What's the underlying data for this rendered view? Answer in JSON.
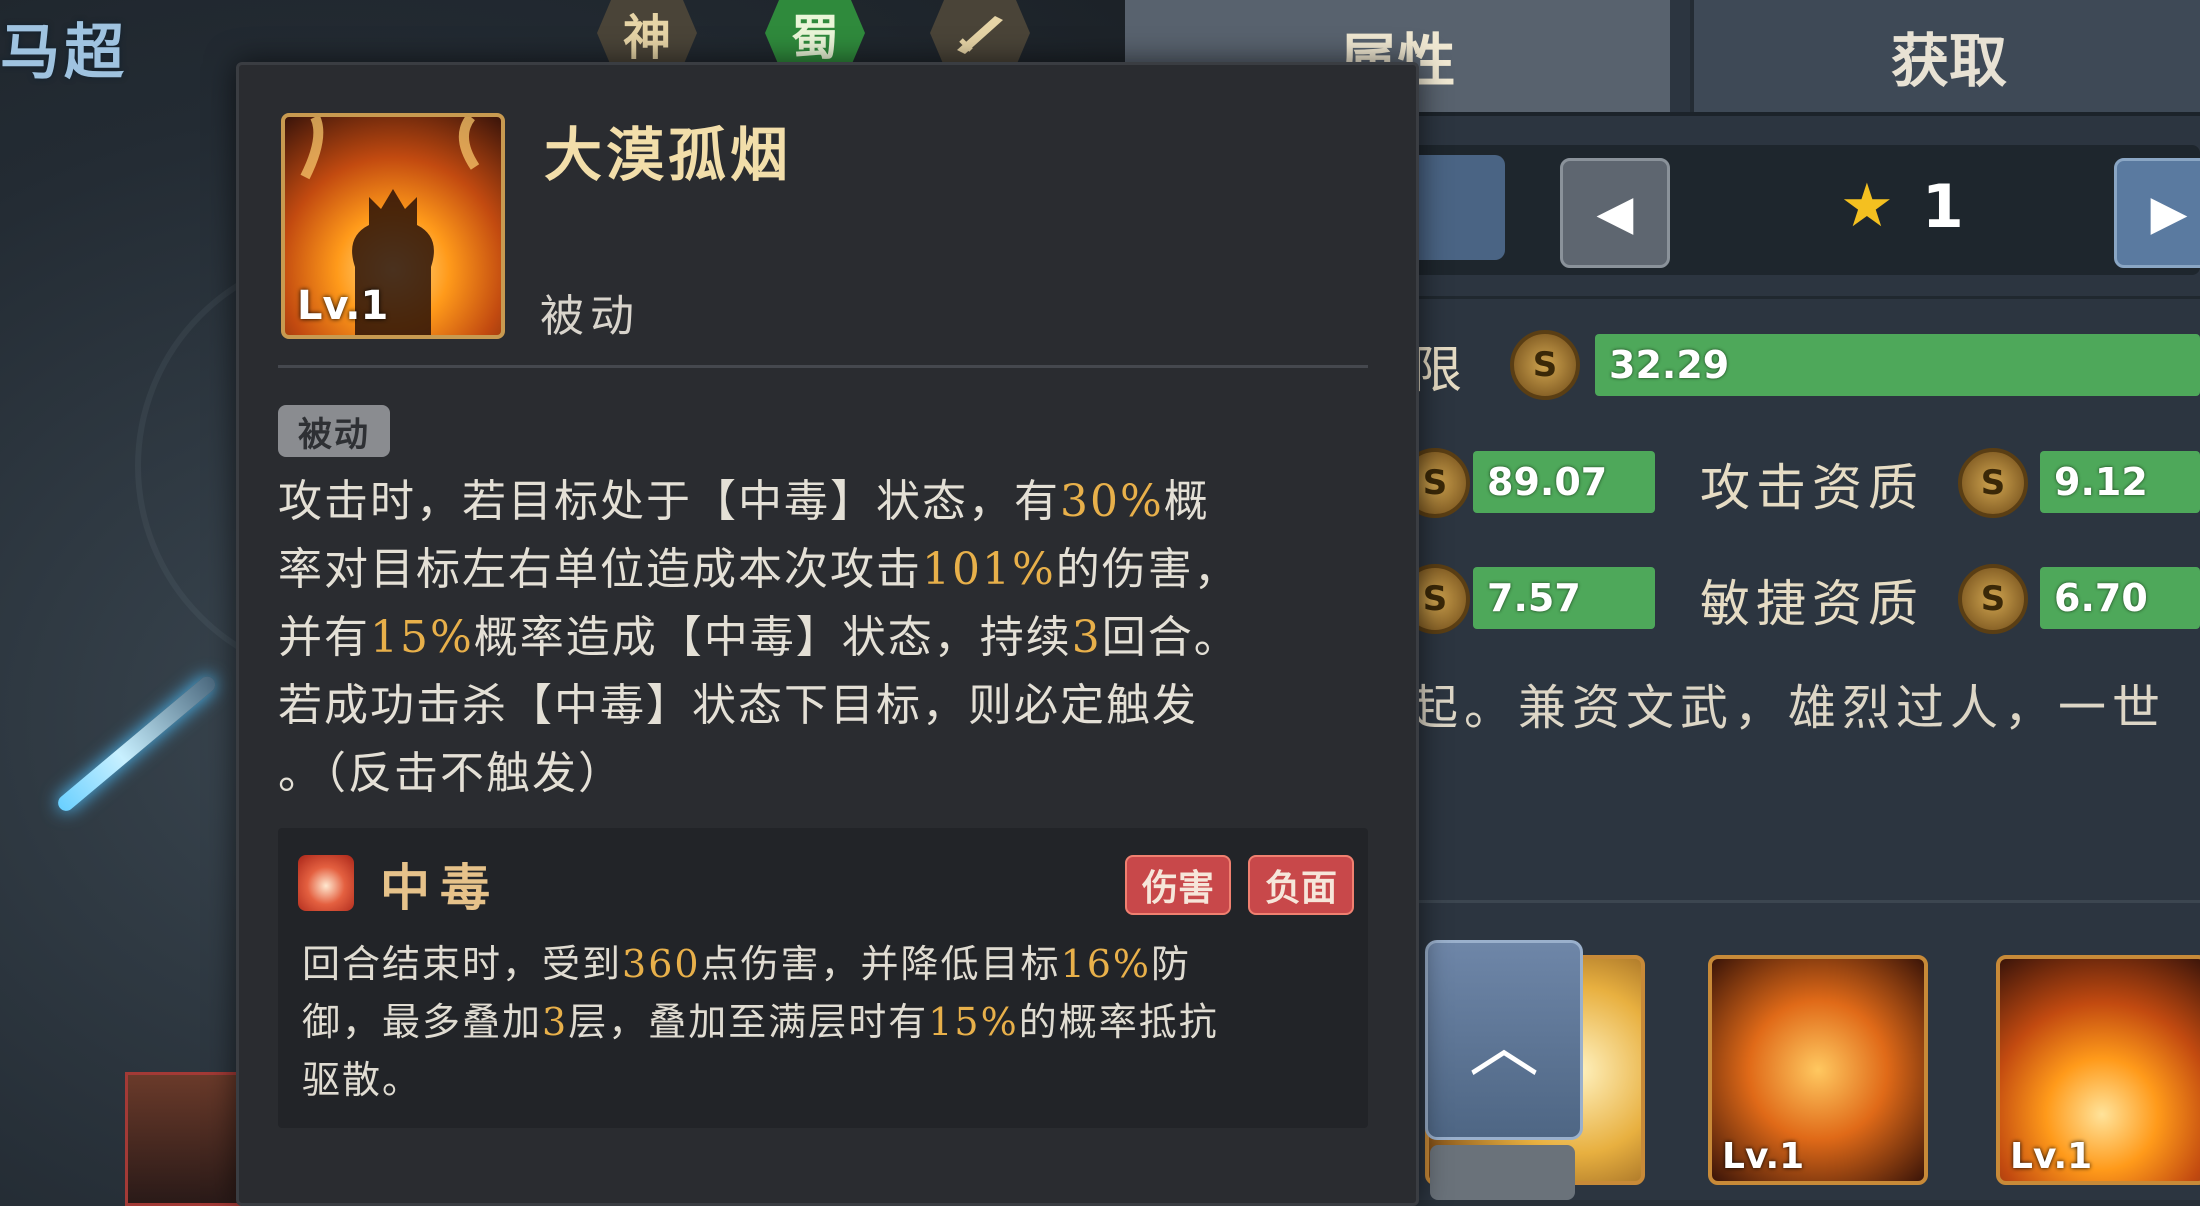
{
  "hero": {
    "name": "马超"
  },
  "factions": [
    "神",
    "蜀",
    "weapon-icon"
  ],
  "tabs": {
    "attributes": "属性",
    "obtain": "获取"
  },
  "star": {
    "count": "1"
  },
  "attributes": {
    "cap_label_partial": "限",
    "cap_value": "32.29",
    "rows": [
      {
        "left_value": "89.07",
        "label": "攻击资质",
        "right_value": "9.12"
      },
      {
        "left_value": "7.57",
        "label": "敏捷资质",
        "right_value": "6.70"
      }
    ]
  },
  "lore_partial": "起。兼资文武，雄烈过人，一世",
  "skill": {
    "name": "大漠孤烟",
    "level": "Lv.1",
    "type": "被动",
    "badge": "被动",
    "description_lines": [
      [
        {
          "t": "攻击时，若目标处于【中毒】状态，有"
        },
        {
          "t": "30%",
          "h": true
        },
        {
          "t": "概"
        }
      ],
      [
        {
          "t": "率对目标左右单位造成本次攻击"
        },
        {
          "t": "101%",
          "h": true
        },
        {
          "t": "的伤害，"
        }
      ],
      [
        {
          "t": "并有"
        },
        {
          "t": "15%",
          "h": true
        },
        {
          "t": "概率造成【中毒】状态，持续"
        },
        {
          "t": "3",
          "h": true
        },
        {
          "t": "回合。"
        }
      ],
      [
        {
          "t": "若成功击杀【中毒】状态下目标，则必定触发"
        }
      ],
      [
        {
          "t": "。（反击不触发）"
        }
      ]
    ]
  },
  "status_effect": {
    "name": "中毒",
    "tags": [
      "伤害",
      "负面"
    ],
    "description_lines": [
      [
        {
          "t": "回合结束时，受到"
        },
        {
          "t": "360",
          "h": true
        },
        {
          "t": "点伤害，并降低目标"
        },
        {
          "t": "16%",
          "h": true
        },
        {
          "t": "防"
        }
      ],
      [
        {
          "t": "御，最多叠加"
        },
        {
          "t": "3",
          "h": true
        },
        {
          "t": "层，叠加至满层时有"
        },
        {
          "t": "15%",
          "h": true
        },
        {
          "t": "的概率抵抗"
        }
      ],
      [
        {
          "t": "驱散。"
        }
      ]
    ]
  },
  "skill_cards": [
    {
      "level": "Lv.1",
      "icon": "dragon-icon"
    },
    {
      "level": "Lv.1",
      "icon": "flame-warrior-icon"
    }
  ],
  "colors": {
    "highlight": "#e8b04a",
    "bar_green": "#4ea85a",
    "tag_red": "#c8484a",
    "star": "#f4c020"
  }
}
